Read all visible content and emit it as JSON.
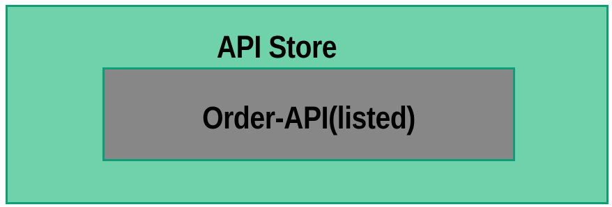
{
  "store": {
    "title": "API Store",
    "fill_color": "#6fd2ab",
    "border_color": "#0f9d76"
  },
  "api": {
    "label": "Order-API(listed)",
    "fill_color": "#878787",
    "border_color": "#0f9d76"
  }
}
